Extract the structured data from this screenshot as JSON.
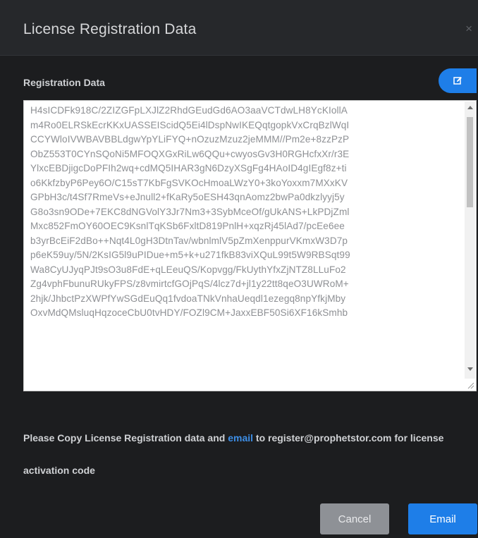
{
  "dialog": {
    "title": "License Registration Data",
    "close_glyph": "×"
  },
  "section": {
    "label": "Registration Data",
    "edit_icon": "edit-icon"
  },
  "registration_data": {
    "lines": [
      "H4sICDFk918C/2ZIZGFpLXJlZ2RhdGEudGd6AO3aaVCTdwLH8YcKIollA",
      "m4Ro0ELRSkEcrKKxUASSEIScidQ5Ei4lDspNwIKEQqtgopkVxCrqBzlWqI",
      "CCYWloIVWBAVBBLdgwYpYLiFYQ+nOzuzMzuz2jeMMM//Pm2e+8zzPzP",
      "ObZ553T0CYnSQoNi5MFOQXGxRiLw6QQu+cwyosGv3H0RGHcfxXr/r3E",
      "YlxcEBDjigcDoPFIh2wq+cdMQ5IHAR3gN6DzyXSgFg4HAoID4gIEgf8z+ti",
      "o6KkfzbyP6Pey6O/C15sT7KbFgSVKOcHmoaLWzY0+3koYoxxm7MXxKV",
      "GPbH3c/t4Sf7RmeVs+eJnull2+fKaRy5oESH43qnAomz2bwPa0dkzlyyj5y",
      "G8o3sn9ODe+7EKC8dNGVolY3Jr7Nm3+3SybMceOf/gUkANS+LkPDjZml",
      "Mxc852FmOY60OEC9KsnlTqKSb6FxltD819PnlH+xqzRj45lAd7/pcEe6ee",
      "b3yrBcEiF2dBo++Nqt4L0gH3DtnTav/wbnlmlV5pZmXenppurVKmxW3D7p",
      "p6eK59uy/5N/2KsIG5l9uPIDue+m5+k+u271fkB83viXQuL99t5W9RBSqt99",
      "Wa8CyUJyqPJt9sO3u8FdE+qLEeuQS/Kopvgg/FkUythYfxZjNTZ8LLuFo2",
      "Zg4vphFbunuRUkyFPS/z8vmirtcfGOjPqS/4lcz7d+jl1y22tt8qeO3UWRoM+",
      "2hjk/JhbctPzXWPfYwSGdEuQq1fvdoaTNkVnhaUeqdl1ezegq8npYfkjMby",
      "OxvMdQMsluqHqzoceCbU0tvHDY/FOZl9CM+JaxxEBF50Si6XF16kSmhb"
    ]
  },
  "note": {
    "text_before": "Please Copy License Registration data and ",
    "link_text": "email",
    "text_after": " to register@prophetstor.com for license activation code"
  },
  "buttons": {
    "cancel": "Cancel",
    "email": "Email"
  },
  "colors": {
    "accent": "#1e7ee8",
    "link": "#3d8ee6",
    "dialog_bg": "#1c1d1f",
    "header_bg": "#26282b",
    "cancel_bg": "#8e9196"
  }
}
